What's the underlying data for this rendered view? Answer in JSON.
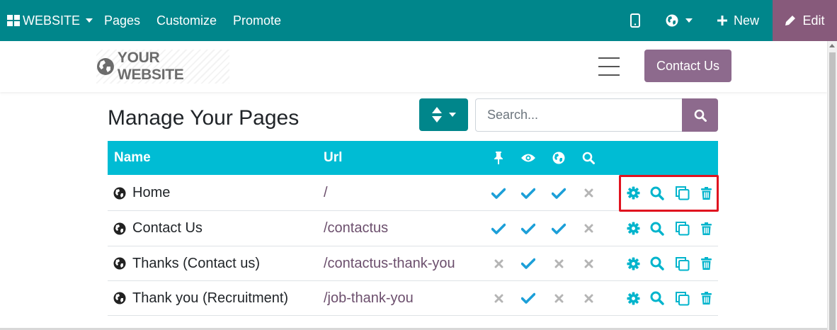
{
  "topbar": {
    "brand": "WEBSITE",
    "menu": [
      "Pages",
      "Customize",
      "Promote"
    ],
    "new_label": "New",
    "edit_label": "Edit",
    "icons": {
      "brand": "grid-icon",
      "mobile": "mobile-preview-icon",
      "language": "globe-icon",
      "new": "plus-icon",
      "edit": "pencil-icon"
    }
  },
  "site": {
    "logo_text": "YOUR WEBSITE",
    "contact_button": "Contact Us"
  },
  "main": {
    "title": "Manage Your Pages",
    "search_placeholder": "Search..."
  },
  "table": {
    "columns": {
      "name": "Name",
      "url": "Url",
      "flag_icons": [
        "pin-icon",
        "eye-icon",
        "globe-icon",
        "search-icon"
      ]
    },
    "rows": [
      {
        "name": "Home",
        "url": "/",
        "flags": [
          true,
          true,
          true,
          false
        ]
      },
      {
        "name": "Contact Us",
        "url": "/contactus",
        "flags": [
          true,
          true,
          true,
          false
        ]
      },
      {
        "name": "Thanks (Contact us)",
        "url": "/contactus-thank-you",
        "flags": [
          false,
          true,
          false,
          false
        ]
      },
      {
        "name": "Thank you (Recruitment)",
        "url": "/job-thank-you",
        "flags": [
          false,
          true,
          false,
          false
        ]
      }
    ],
    "row_action_icons": [
      "gear-icon",
      "search-icon",
      "clone-icon",
      "trash-icon"
    ]
  },
  "colors": {
    "topbar": "#00868b",
    "edit": "#875a7b",
    "accent_purple": "#8d6a8d",
    "table_header": "#00bcd4",
    "check": "#1c9fd8",
    "cross": "#b5b5b5",
    "action": "#00b4cc",
    "highlight": "#e0131f"
  }
}
